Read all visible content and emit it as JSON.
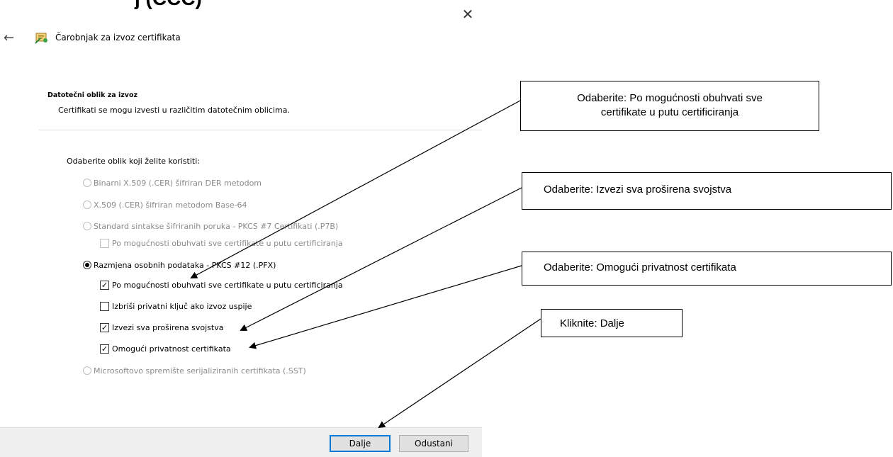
{
  "window": {
    "cut_title": "ј (ССС)",
    "close_icon": "close-icon",
    "back_icon": "back-arrow-icon",
    "wizard_icon": "certificate-wizard-icon",
    "wizard_title": "Čarobnjak za izvoz certifikata"
  },
  "section": {
    "title": "Datotečni oblik za izvoz",
    "description": "Certifikati se mogu izvesti u različitim datotečnim oblicima."
  },
  "choose_label": "Odaberite oblik koji želite koristiti:",
  "options": [
    {
      "type": "radio",
      "label": "Binarni X.509 (.CER) šifriran DER metodom",
      "checked": false,
      "enabled": false
    },
    {
      "type": "radio",
      "label": "X.509 (.CER) šifriran metodom Base-64",
      "checked": false,
      "enabled": false
    },
    {
      "type": "radio",
      "label": "Standard sintakse šifriranih poruka - PKCS #7 Certifikati (.P7B)",
      "checked": false,
      "enabled": false
    },
    {
      "type": "checkbox",
      "label": "Po mogućnosti obuhvati sve certifikate u putu certificiranja",
      "checked": false,
      "enabled": false
    },
    {
      "type": "radio",
      "label": "Razmjena osobnih podataka - PKCS #12 (.PFX)",
      "checked": true,
      "enabled": true
    },
    {
      "type": "checkbox",
      "label": "Po mogućnosti obuhvati sve certifikate u putu certificiranja",
      "checked": true,
      "enabled": true
    },
    {
      "type": "checkbox",
      "label": "Izbriši privatni ključ ako izvoz uspije",
      "checked": false,
      "enabled": true
    },
    {
      "type": "checkbox",
      "label": "Izvezi sva proširena svojstva",
      "checked": true,
      "enabled": true
    },
    {
      "type": "checkbox",
      "label": "Omogući privatnost certifikata",
      "checked": true,
      "enabled": true
    },
    {
      "type": "radio",
      "label": "Microsoftovo spremište serijaliziranih certifikata (.SST)",
      "checked": false,
      "enabled": false
    }
  ],
  "buttons": {
    "next": "Dalje",
    "cancel": "Odustani"
  },
  "callouts": {
    "c1_line1": "Odaberite: Po mogućnosti obuhvati sve",
    "c1_line2": "certifikate u putu certificiranja",
    "c2": "Odaberite: Izvezi sva proširena svojstva",
    "c3": "Odaberite: Omogući privatnost certifikata",
    "c4": "Kliknite: Dalje"
  },
  "colors": {
    "accent": "#0078d7",
    "disabled_text": "#8a8a8a",
    "footer": "#f0f0f0"
  }
}
